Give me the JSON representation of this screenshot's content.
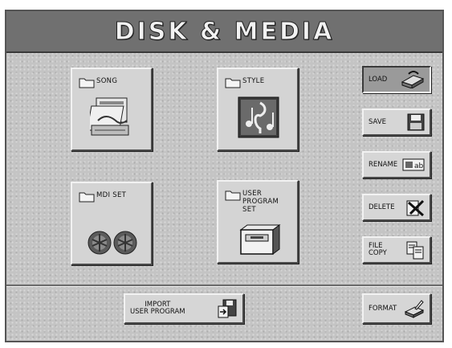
{
  "screen": {
    "title": "DISK & MEDIA"
  },
  "main_buttons": {
    "song": {
      "label": "SONG",
      "icon": "song-files-icon"
    },
    "style": {
      "label": "STYLE",
      "icon": "music-notes-icon"
    },
    "mdiset": {
      "label": "MDI SET",
      "icon": "disk-pair-icon"
    },
    "user_program_set": {
      "label": "USER\nPROGRAM\nSET",
      "icon": "file-box-icon"
    }
  },
  "side_buttons": {
    "load": {
      "label": "LOAD",
      "icon": "load-disk-icon"
    },
    "save": {
      "label": "SAVE",
      "icon": "floppy-disk-icon"
    },
    "rename": {
      "label": "RENAME",
      "icon": "rename-ab-icon"
    },
    "delete": {
      "label": "DELETE",
      "icon": "delete-x-icon"
    },
    "file_copy": {
      "label": "FILE\nCOPY",
      "icon": "copy-pages-icon"
    }
  },
  "bottom_buttons": {
    "import": {
      "label": "IMPORT\nUSER PROGRAM",
      "icon": "import-disk-icon"
    },
    "format": {
      "label": "FORMAT",
      "icon": "format-disk-icon"
    }
  }
}
